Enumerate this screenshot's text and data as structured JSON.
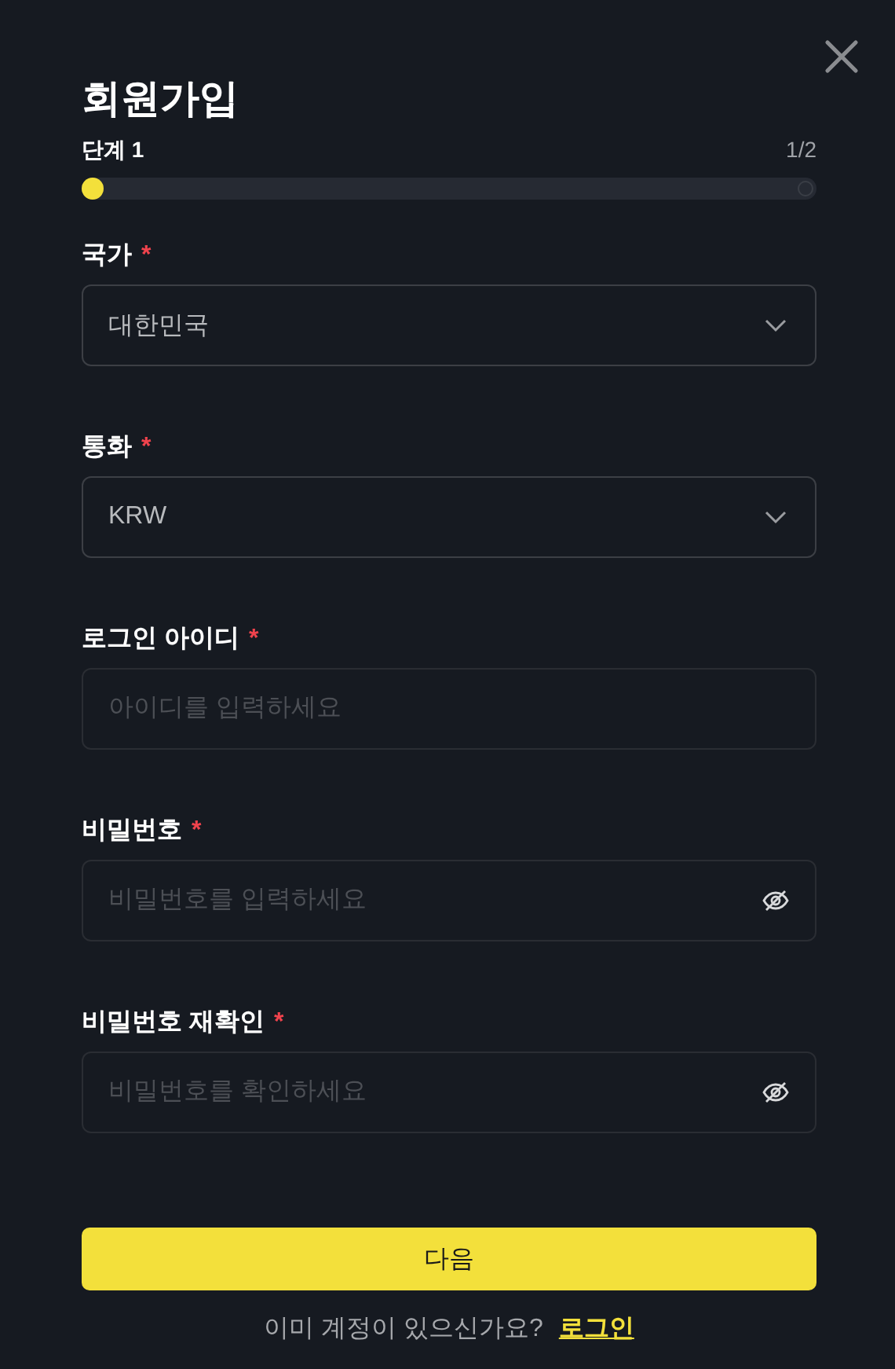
{
  "title": "회원가입",
  "step": {
    "label": "단계 1",
    "count": "1/2",
    "level": 0
  },
  "fields": [
    {
      "kind": "select",
      "label": "국가",
      "marker": "*",
      "value": "대한민국"
    },
    {
      "kind": "select",
      "label": "통화",
      "marker": "*",
      "value": "KRW"
    },
    {
      "kind": "text",
      "label": "로그인 아이디",
      "marker": "*",
      "placeholder": "아이디를 입력하세요"
    },
    {
      "kind": "password",
      "label": "비밀번호",
      "marker": "*",
      "placeholder": "비밀번호를 입력하세요"
    },
    {
      "kind": "password",
      "label": "비밀번호 재확인",
      "marker": "*",
      "placeholder": "비밀번호를 확인하세요"
    }
  ],
  "next_button": "다음",
  "footer": {
    "question": "이미 계정이 있으신가요?",
    "link": "로그인"
  }
}
